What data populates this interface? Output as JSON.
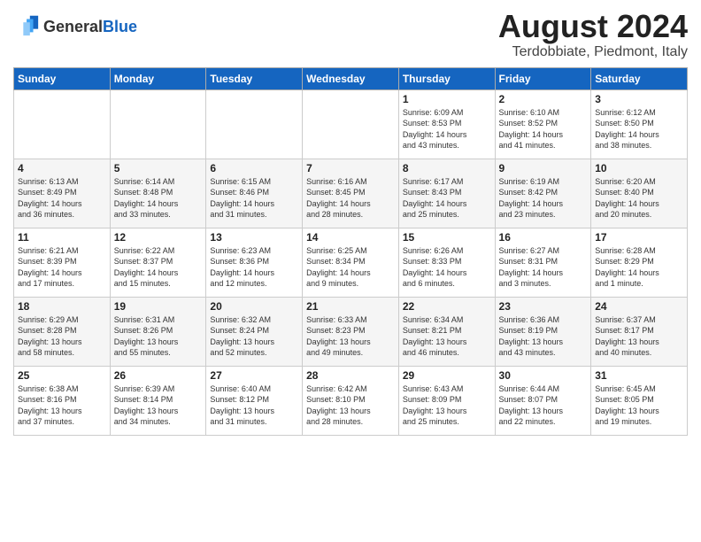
{
  "header": {
    "logo_general": "General",
    "logo_blue": "Blue",
    "month_title": "August 2024",
    "location": "Terdobbiate, Piedmont, Italy"
  },
  "days_of_week": [
    "Sunday",
    "Monday",
    "Tuesday",
    "Wednesday",
    "Thursday",
    "Friday",
    "Saturday"
  ],
  "weeks": [
    [
      {
        "num": "",
        "info": ""
      },
      {
        "num": "",
        "info": ""
      },
      {
        "num": "",
        "info": ""
      },
      {
        "num": "",
        "info": ""
      },
      {
        "num": "1",
        "info": "Sunrise: 6:09 AM\nSunset: 8:53 PM\nDaylight: 14 hours\nand 43 minutes."
      },
      {
        "num": "2",
        "info": "Sunrise: 6:10 AM\nSunset: 8:52 PM\nDaylight: 14 hours\nand 41 minutes."
      },
      {
        "num": "3",
        "info": "Sunrise: 6:12 AM\nSunset: 8:50 PM\nDaylight: 14 hours\nand 38 minutes."
      }
    ],
    [
      {
        "num": "4",
        "info": "Sunrise: 6:13 AM\nSunset: 8:49 PM\nDaylight: 14 hours\nand 36 minutes."
      },
      {
        "num": "5",
        "info": "Sunrise: 6:14 AM\nSunset: 8:48 PM\nDaylight: 14 hours\nand 33 minutes."
      },
      {
        "num": "6",
        "info": "Sunrise: 6:15 AM\nSunset: 8:46 PM\nDaylight: 14 hours\nand 31 minutes."
      },
      {
        "num": "7",
        "info": "Sunrise: 6:16 AM\nSunset: 8:45 PM\nDaylight: 14 hours\nand 28 minutes."
      },
      {
        "num": "8",
        "info": "Sunrise: 6:17 AM\nSunset: 8:43 PM\nDaylight: 14 hours\nand 25 minutes."
      },
      {
        "num": "9",
        "info": "Sunrise: 6:19 AM\nSunset: 8:42 PM\nDaylight: 14 hours\nand 23 minutes."
      },
      {
        "num": "10",
        "info": "Sunrise: 6:20 AM\nSunset: 8:40 PM\nDaylight: 14 hours\nand 20 minutes."
      }
    ],
    [
      {
        "num": "11",
        "info": "Sunrise: 6:21 AM\nSunset: 8:39 PM\nDaylight: 14 hours\nand 17 minutes."
      },
      {
        "num": "12",
        "info": "Sunrise: 6:22 AM\nSunset: 8:37 PM\nDaylight: 14 hours\nand 15 minutes."
      },
      {
        "num": "13",
        "info": "Sunrise: 6:23 AM\nSunset: 8:36 PM\nDaylight: 14 hours\nand 12 minutes."
      },
      {
        "num": "14",
        "info": "Sunrise: 6:25 AM\nSunset: 8:34 PM\nDaylight: 14 hours\nand 9 minutes."
      },
      {
        "num": "15",
        "info": "Sunrise: 6:26 AM\nSunset: 8:33 PM\nDaylight: 14 hours\nand 6 minutes."
      },
      {
        "num": "16",
        "info": "Sunrise: 6:27 AM\nSunset: 8:31 PM\nDaylight: 14 hours\nand 3 minutes."
      },
      {
        "num": "17",
        "info": "Sunrise: 6:28 AM\nSunset: 8:29 PM\nDaylight: 14 hours\nand 1 minute."
      }
    ],
    [
      {
        "num": "18",
        "info": "Sunrise: 6:29 AM\nSunset: 8:28 PM\nDaylight: 13 hours\nand 58 minutes."
      },
      {
        "num": "19",
        "info": "Sunrise: 6:31 AM\nSunset: 8:26 PM\nDaylight: 13 hours\nand 55 minutes."
      },
      {
        "num": "20",
        "info": "Sunrise: 6:32 AM\nSunset: 8:24 PM\nDaylight: 13 hours\nand 52 minutes."
      },
      {
        "num": "21",
        "info": "Sunrise: 6:33 AM\nSunset: 8:23 PM\nDaylight: 13 hours\nand 49 minutes."
      },
      {
        "num": "22",
        "info": "Sunrise: 6:34 AM\nSunset: 8:21 PM\nDaylight: 13 hours\nand 46 minutes."
      },
      {
        "num": "23",
        "info": "Sunrise: 6:36 AM\nSunset: 8:19 PM\nDaylight: 13 hours\nand 43 minutes."
      },
      {
        "num": "24",
        "info": "Sunrise: 6:37 AM\nSunset: 8:17 PM\nDaylight: 13 hours\nand 40 minutes."
      }
    ],
    [
      {
        "num": "25",
        "info": "Sunrise: 6:38 AM\nSunset: 8:16 PM\nDaylight: 13 hours\nand 37 minutes."
      },
      {
        "num": "26",
        "info": "Sunrise: 6:39 AM\nSunset: 8:14 PM\nDaylight: 13 hours\nand 34 minutes."
      },
      {
        "num": "27",
        "info": "Sunrise: 6:40 AM\nSunset: 8:12 PM\nDaylight: 13 hours\nand 31 minutes."
      },
      {
        "num": "28",
        "info": "Sunrise: 6:42 AM\nSunset: 8:10 PM\nDaylight: 13 hours\nand 28 minutes."
      },
      {
        "num": "29",
        "info": "Sunrise: 6:43 AM\nSunset: 8:09 PM\nDaylight: 13 hours\nand 25 minutes."
      },
      {
        "num": "30",
        "info": "Sunrise: 6:44 AM\nSunset: 8:07 PM\nDaylight: 13 hours\nand 22 minutes."
      },
      {
        "num": "31",
        "info": "Sunrise: 6:45 AM\nSunset: 8:05 PM\nDaylight: 13 hours\nand 19 minutes."
      }
    ]
  ]
}
